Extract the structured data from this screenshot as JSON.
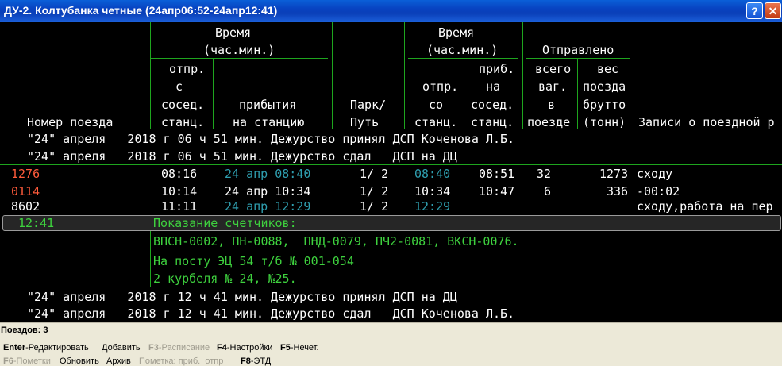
{
  "window": {
    "title": "ДУ-2. Колтубанка четные (24апр06:52-24апр12:41)",
    "help_label": "?",
    "close_label": "✕"
  },
  "header": {
    "vremya1": "Время",
    "chasmin1": "(час.мин.)",
    "otpr_lines": [
      "отпр.",
      "с",
      "сосед.",
      "станц."
    ],
    "pribytiya_lines": [
      "прибытия",
      "на станцию"
    ],
    "nomer": "Номер поезда",
    "park_lines": [
      "Парк/",
      "Путь"
    ],
    "vremya2": "Время",
    "chasmin2": "(час.мин.)",
    "otpr2_lines": [
      "отпр.",
      "со",
      "станц."
    ],
    "prib2_lines": [
      "приб.",
      "на",
      "сосед.",
      "станц."
    ],
    "otpravleno": "Отправлено",
    "vsego_lines": [
      "всего",
      "ваг.",
      "в",
      "поезде"
    ],
    "ves_lines": [
      "вес",
      "поезда",
      "брутто",
      "(тонн)"
    ],
    "zapisi": "Записи о поездной р"
  },
  "duty_top": [
    "\"24\" апреля   2018 г 06 ч 51 мин. Дежурство принял ДСП Коченова Л.Б.",
    "\"24\" апреля   2018 г 06 ч 51 мин. Дежурство сдал   ДСП на ДЦ"
  ],
  "trains": [
    {
      "num": "1276",
      "otpr": "08:16",
      "prib": "24 апр 08:40",
      "park": "1/ 2",
      "otpr2": "08:40",
      "prib2": "08:51",
      "vagons": "32",
      "weight": "1273",
      "note": "сходу"
    },
    {
      "num": "0114",
      "otpr": "10:14",
      "prib": "24 апр 10:34",
      "park": "1/ 2",
      "otpr2": "10:34",
      "prib2": "10:47",
      "vagons": "6",
      "weight": "336",
      "note": "-00:02"
    },
    {
      "num": "8602",
      "otpr": "11:11",
      "prib": "24 апр 12:29",
      "park": "1/ 2",
      "otpr2": "12:29",
      "prib2": "",
      "vagons": "",
      "weight": "",
      "note": "сходу,работа на пер"
    }
  ],
  "counter": {
    "time": "12:41",
    "title": "Показание счетчиков:",
    "line1": "ВПСН-0002, ПН-0088,  ПНД-0079, ПЧ2-0081, ВКСН-0076.",
    "line2": "На посту ЭЦ 54 т/б № 001-054",
    "line3": "2 курбеля № 24, №25."
  },
  "duty_bottom": [
    "\"24\" апреля   2018 г 12 ч 41 мин. Дежурство принял ДСП на ДЦ",
    "\"24\" апреля   2018 г 12 ч 41 мин. Дежурство сдал   ДСП Коченова Л.Б."
  ],
  "status": {
    "count_label": "Поездов: 3",
    "row1": [
      {
        "key": "Enter",
        "text": "-Редактировать"
      },
      {
        "key": "",
        "text": "Добавить"
      },
      {
        "key": "F3",
        "text": "-Расписание",
        "disabled": true
      },
      {
        "key": "F4",
        "text": "-Настройки"
      },
      {
        "key": "F5",
        "text": "-Нечет."
      }
    ],
    "row2": [
      {
        "key": "F6",
        "text": "-Пометки",
        "disabled": true
      },
      {
        "key": "",
        "text": "Обновить"
      },
      {
        "key": "",
        "text": "Архив"
      },
      {
        "key": "",
        "text": "Пометка: приб.  отпр",
        "disabled": true
      },
      {
        "key": "F8",
        "text": "-ЭТД"
      }
    ]
  },
  "colors": {
    "grid": "#1ea51e",
    "text_green": "#3ed13e",
    "text_cyan": "#2f9fb0",
    "text_red": "#ff5b3b"
  }
}
